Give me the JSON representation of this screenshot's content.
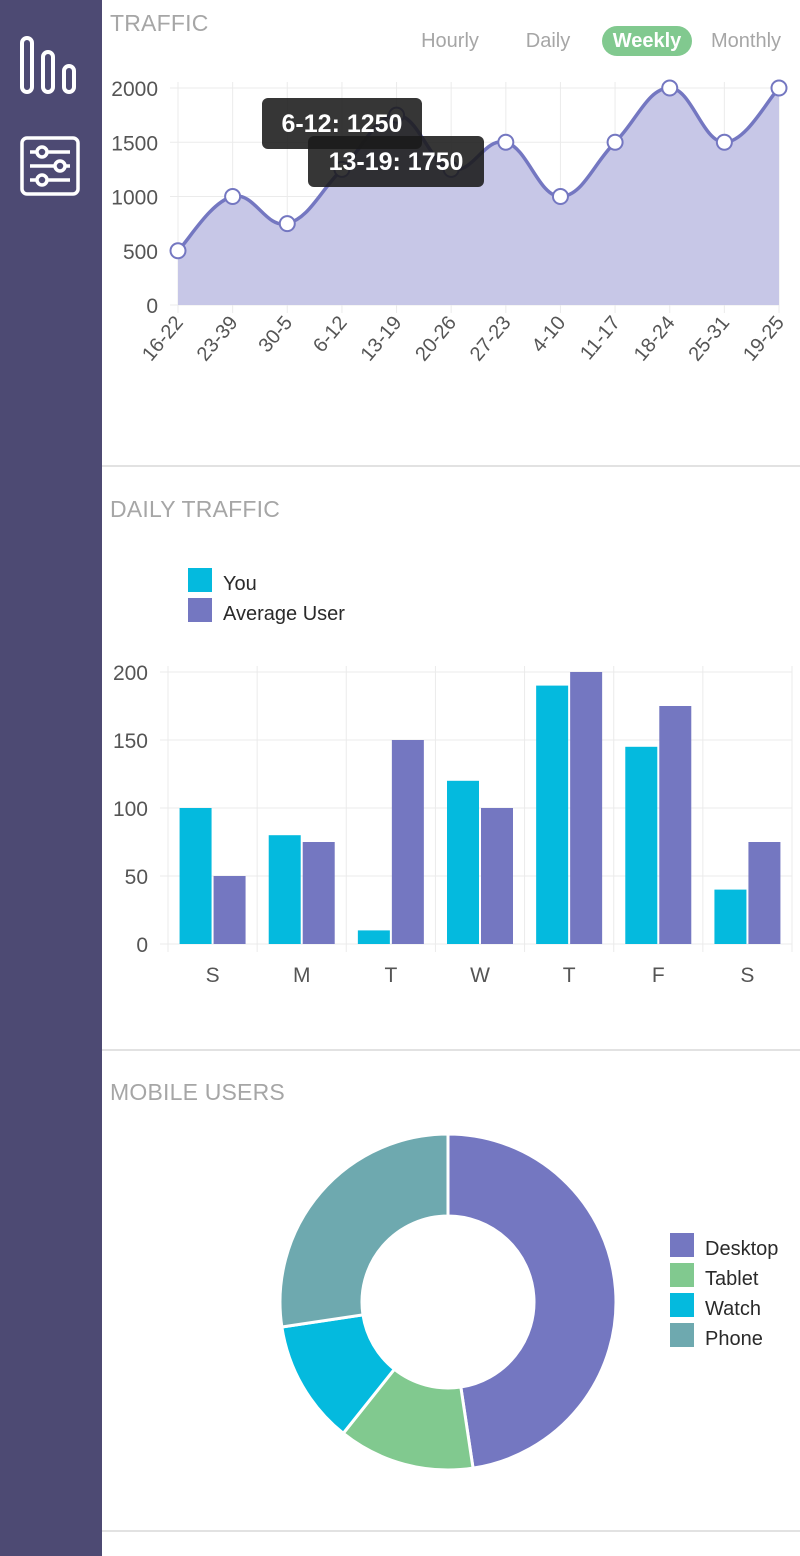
{
  "sidebar": {
    "items": [
      {
        "icon": "bar-chart-icon"
      },
      {
        "icon": "sliders-icon"
      }
    ]
  },
  "traffic": {
    "title": "TRAFFIC",
    "tabs": [
      {
        "label": "Hourly",
        "active": false
      },
      {
        "label": "Daily",
        "active": false
      },
      {
        "label": "Weekly",
        "active": true
      },
      {
        "label": "Monthly",
        "active": false
      }
    ],
    "tooltips": [
      "6-12: 1250",
      "13-19: 1750"
    ]
  },
  "daily_traffic": {
    "title": "DAILY TRAFFIC",
    "legend": [
      "You",
      "Average User"
    ]
  },
  "mobile_users": {
    "title": "MOBILE USERS",
    "legend": [
      "Desktop",
      "Tablet",
      "Watch",
      "Phone"
    ]
  },
  "colors": {
    "sidebar": "#4d4a73",
    "accent_green": "#81c98f",
    "purple": "#7477c1",
    "purple_fill": "#c7c7e7",
    "cyan": "#04bade",
    "teal": "#6ea9af",
    "green": "#81c98f"
  },
  "chart_data": [
    {
      "type": "area",
      "categories": [
        "16-22",
        "23-39",
        "30-5",
        "6-12",
        "13-19",
        "20-26",
        "27-23",
        "4-10",
        "11-17",
        "18-24",
        "25-31",
        "19-25"
      ],
      "values": [
        500,
        1000,
        750,
        1250,
        1750,
        1250,
        1500,
        1000,
        1500,
        2000,
        1500,
        2000
      ],
      "yticks": [
        0,
        500,
        1000,
        1500,
        2000
      ],
      "ylim": [
        0,
        2000
      ],
      "grid": true
    },
    {
      "type": "bar",
      "categories": [
        "S",
        "M",
        "T",
        "W",
        "T",
        "F",
        "S"
      ],
      "series": [
        {
          "name": "You",
          "values": [
            100,
            80,
            10,
            120,
            190,
            145,
            40
          ]
        },
        {
          "name": "Average User",
          "values": [
            50,
            75,
            150,
            100,
            200,
            175,
            75
          ]
        }
      ],
      "yticks": [
        0,
        50,
        100,
        150,
        200
      ],
      "ylim": [
        0,
        200
      ],
      "legend": "top-left",
      "grid": true
    },
    {
      "type": "pie",
      "labels": [
        "Desktop",
        "Tablet",
        "Watch",
        "Phone"
      ],
      "values": [
        2000,
        550,
        500,
        1150
      ],
      "donut": true,
      "legend": "right"
    }
  ]
}
